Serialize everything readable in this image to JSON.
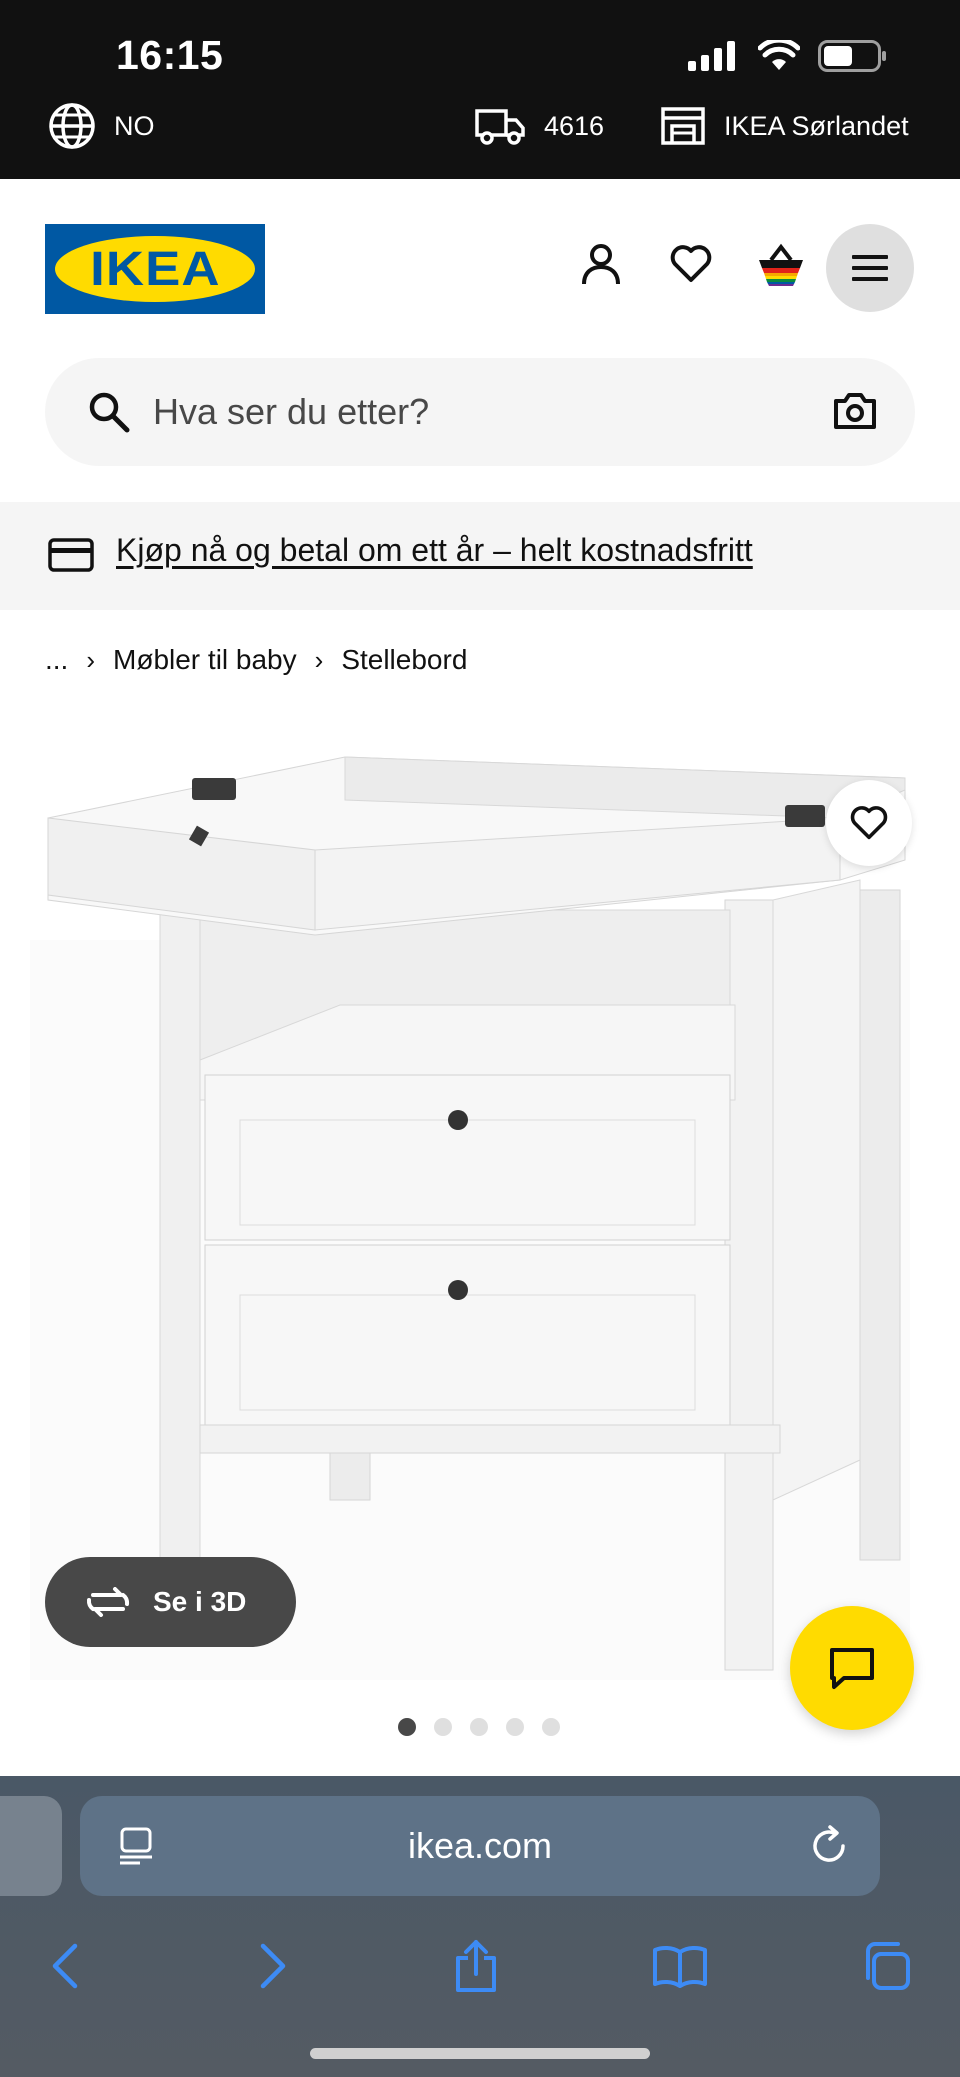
{
  "status": {
    "time": "16:15"
  },
  "utility": {
    "language": "NO",
    "postcode": "4616",
    "store": "IKEA Sørlandet"
  },
  "header": {
    "logo_text": "IKEA",
    "brand_blue": "#0058a3",
    "brand_yellow": "#ffdb00"
  },
  "search": {
    "placeholder": "Hva ser du etter?"
  },
  "promo": {
    "text": "Kjøp nå og betal om ett år – helt kostnadsfritt"
  },
  "breadcrumb": {
    "ellipsis": "...",
    "items": [
      "Møbler til baby",
      "Stellebord"
    ]
  },
  "product": {
    "view_3d_label": "Se i 3D",
    "image_count": 5,
    "active_image": 1
  },
  "browser": {
    "url": "ikea.com"
  },
  "icons": {
    "globe": "globe-icon",
    "truck": "truck-icon",
    "store": "store-icon",
    "account": "account-icon",
    "wishlist": "heart-icon",
    "cart": "basket-icon",
    "menu": "hamburger-icon",
    "search": "search-icon",
    "camera": "camera-icon",
    "card": "credit-card-icon",
    "rotate": "rotate-3d-icon",
    "chat": "chat-icon"
  }
}
